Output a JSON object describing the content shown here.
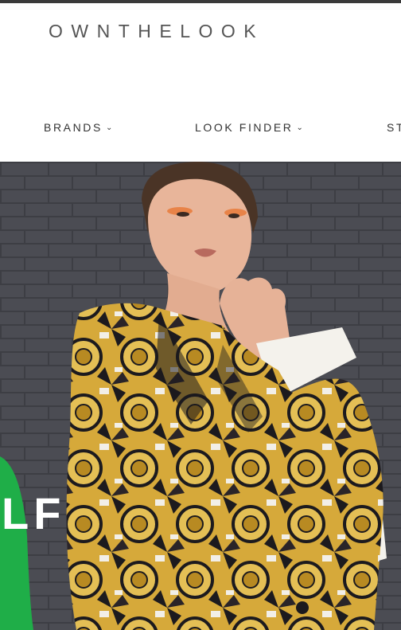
{
  "brand": {
    "logo_text": "OWNTHELOOK"
  },
  "nav": {
    "items": [
      {
        "label": "BRANDS",
        "chevron": "⌄"
      },
      {
        "label": "LOOK FINDER",
        "chevron": "⌄"
      },
      {
        "label": "ST"
      }
    ]
  },
  "hero": {
    "overlay_text": "LF"
  },
  "colors": {
    "top_border": "#3a3a3a",
    "wall": "#4a4b52",
    "accent_green": "#1fae48",
    "garment_gold": "#d9ad32",
    "garment_dark": "#1c1a1e"
  },
  "icons": {
    "nav_chevron": "chevron-down-icon"
  }
}
